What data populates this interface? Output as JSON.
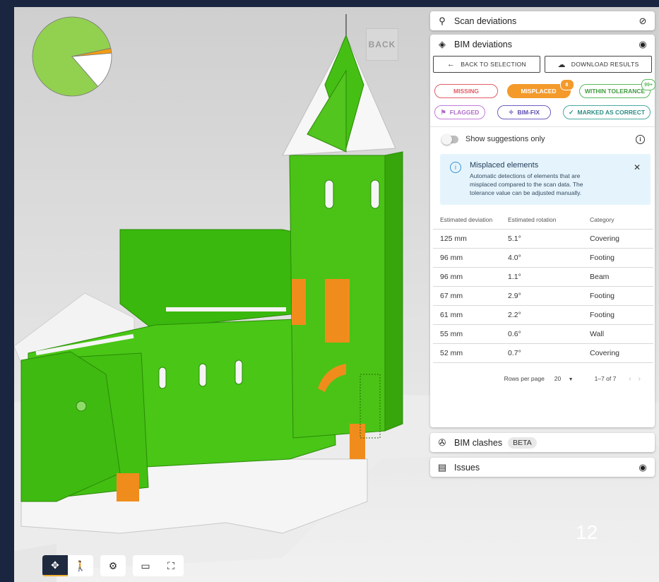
{
  "viewer": {
    "back_label": "BACK",
    "slide_number": "12"
  },
  "pie_chart": {
    "segments": [
      {
        "value": 83,
        "color": "#92d050"
      },
      {
        "value": 2,
        "color": "#f39c12"
      },
      {
        "value": 15,
        "color": "#ffffff"
      }
    ]
  },
  "toolbar": {
    "groups": [
      [
        "orbit-icon",
        "walk-icon"
      ],
      [
        "settings-icon"
      ],
      [
        "screen-icon",
        "fullscreen-icon"
      ]
    ]
  },
  "scan_deviations": {
    "title": "Scan deviations"
  },
  "bim_deviations": {
    "title": "BIM deviations",
    "back_button": "BACK TO SELECTION",
    "download_button": "DOWNLOAD RESULTS",
    "filters": {
      "missing": "MISSING",
      "misplaced": "MISPLACED",
      "misplaced_count": "8",
      "within": "WITHIN TOLERANCE",
      "within_count": "99+",
      "flagged": "FLAGGED",
      "bimfix": "BIM-FIX",
      "marked": "MARKED AS CORRECT"
    },
    "colors": {
      "missing": "#e05c66",
      "misplaced": "#f39a2b",
      "within": "#5cb85c",
      "flagged": "#c27bd9",
      "bimfix": "#6c5fc0",
      "marked": "#48a8a0"
    },
    "suggestions_label": "Show suggestions only",
    "alert": {
      "title": "Misplaced elements",
      "text": "Automatic detections of elements that are misplaced compared to the scan data. The tolerance value can be adjusted manually."
    },
    "table": {
      "headers": [
        "Estimated deviation",
        "Estimated rotation",
        "Category"
      ],
      "rows": [
        [
          "125 mm",
          "5.1°",
          "Covering"
        ],
        [
          "96 mm",
          "4.0°",
          "Footing"
        ],
        [
          "96 mm",
          "1.1°",
          "Beam"
        ],
        [
          "67 mm",
          "2.9°",
          "Footing"
        ],
        [
          "61 mm",
          "2.2°",
          "Footing"
        ],
        [
          "55 mm",
          "0.6°",
          "Wall"
        ],
        [
          "52 mm",
          "0.7°",
          "Covering"
        ]
      ]
    },
    "pagination": {
      "rows_label": "Rows per page",
      "rows_value": "20",
      "range": "1–7 of 7"
    }
  },
  "bim_clashes": {
    "title": "BIM clashes",
    "badge": "BETA"
  },
  "issues": {
    "title": "Issues"
  }
}
